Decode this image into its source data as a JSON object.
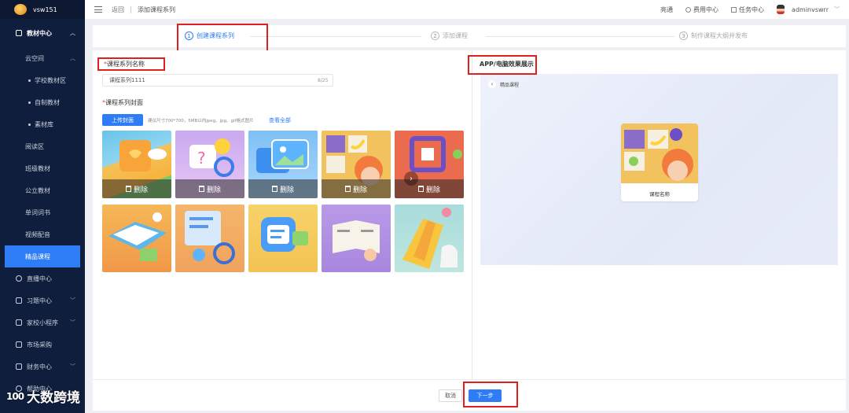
{
  "sidebar": {
    "brand": "vsw151",
    "group_materials": "教材中心",
    "cloud_space": "云空间",
    "leaf_school": "学校教材区",
    "leaf_custom": "自制教材",
    "leaf_library": "素材库",
    "item_reading": "阅读区",
    "item_class": "班级教材",
    "item_public": "公立教材",
    "item_words": "单词词书",
    "item_video": "视频配音",
    "item_premium": "精品课程",
    "live": "直播中心",
    "exercise": "习题中心",
    "miniapp": "家校小程序",
    "market": "市场采购",
    "finance": "财务中心",
    "help": "帮助中心"
  },
  "topbar": {
    "back": "返回",
    "breadcrumb": "添加课程系列",
    "view": "亮通",
    "billing": "费用中心",
    "tasks": "任务中心",
    "user": "adminvswrr"
  },
  "steps": [
    {
      "num": "1",
      "label": "创建课程系列"
    },
    {
      "num": "2",
      "label": "添加课程"
    },
    {
      "num": "3",
      "label": "制作课程大纲并发布"
    }
  ],
  "form": {
    "name_label": "课程系列名称",
    "name_value": "课程系列1111",
    "name_counter": "8/25",
    "cover_label": "课程系列封面",
    "upload_button": "上传封面",
    "hint": "建议尺寸700*700，5MB以内jpeg、jpg、gif格式图片",
    "view_all": "查看全部",
    "delete_label": "删除"
  },
  "preview": {
    "title": "APP/电脑效果展示",
    "back_label": "精品课程",
    "course_name": "课程名称"
  },
  "footer": {
    "cancel": "取消",
    "next": "下一步"
  },
  "watermark": {
    "logo": "100",
    "text": "大数跨境"
  },
  "colors": {
    "primary": "#2e7cf6",
    "sidebar_bg": "#0f1e3c",
    "highlight": "#e0201e"
  }
}
